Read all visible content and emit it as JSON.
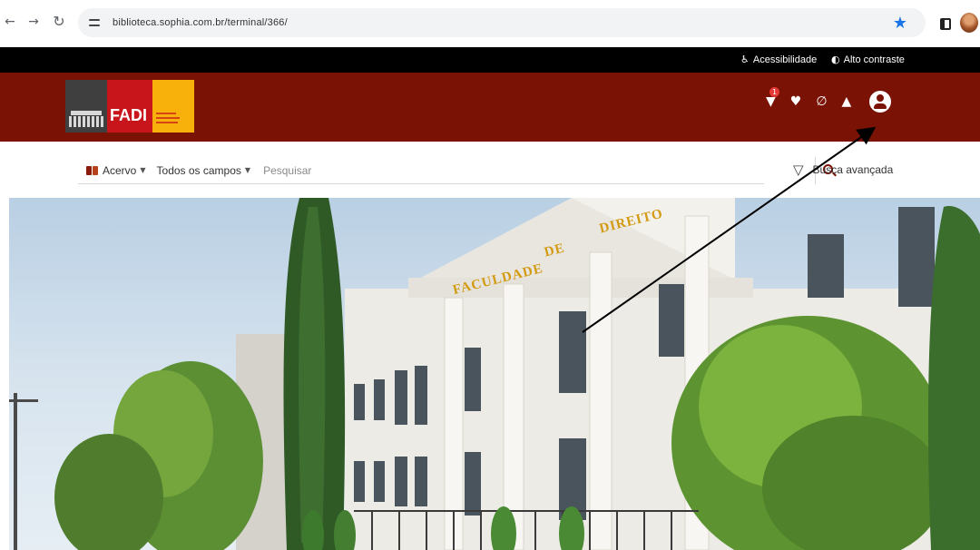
{
  "browser": {
    "url": "biblioteca.sophia.com.br/terminal/366/",
    "back": "←",
    "forward": "→",
    "reload": "↻",
    "bookmark_star": "★"
  },
  "accessibility_bar": {
    "accessibility_label": "Acessibilidade",
    "contrast_label": "Alto contraste"
  },
  "header": {
    "logo_text": "FADI",
    "icons": [
      "bookmark-icon",
      "heart-icon",
      "link-icon",
      "graduation-cap-icon",
      "user-icon"
    ],
    "badge_count": "1"
  },
  "search": {
    "collection_label": "Acervo",
    "fields_label": "Todos os campos",
    "placeholder": "Pesquisar",
    "advanced_label": "Busca avançada"
  },
  "hero": {
    "facade_word_1": "FACULDADE",
    "facade_word_2": "DE",
    "facade_word_3": "DIREITO"
  },
  "colors": {
    "header_bg": "#7a1205",
    "access_bar_bg": "#000000",
    "logo_red": "#c8151b",
    "logo_yellow": "#f7b10a"
  }
}
